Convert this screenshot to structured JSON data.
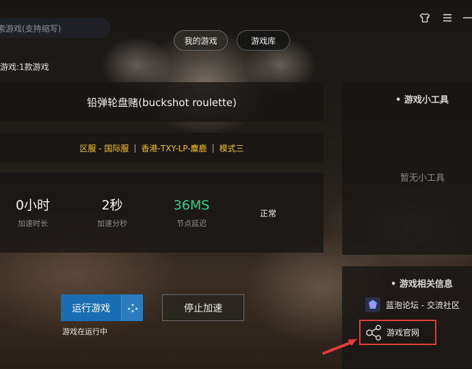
{
  "top": {
    "search_placeholder": "搜索游戏(支持缩写)",
    "search_visible": "索游戏(支持缩写)",
    "tabs": [
      {
        "label": "我的游戏",
        "active": true
      },
      {
        "label": "游戏库",
        "active": false
      }
    ],
    "icons": [
      "shirt-icon",
      "menu-icon",
      "minimize-icon"
    ]
  },
  "game_count": "游戏:1款游戏",
  "game": {
    "title": "铅弹轮盘赌(buckshot roulette)",
    "route": {
      "region": "区服 - 国际服",
      "node": "香港-TXY-LP-麋鹿",
      "mode": "模式三",
      "separator": "|",
      "color": "#f3c21b"
    },
    "stats": [
      {
        "value": "0小时",
        "label": "加速时长"
      },
      {
        "value": "2秒",
        "label": "加速分秒"
      },
      {
        "value": "36MS",
        "label": "节点延迟",
        "color": "#2fd08a"
      }
    ],
    "status": "正常"
  },
  "tools": {
    "heading": "• 游戏小工具",
    "empty": "暂无小工具"
  },
  "info": {
    "heading": "• 游戏相关信息",
    "forum": "蓝泡论坛 - 交流社区",
    "official": "游戏官网"
  },
  "actions": {
    "run": "运行游戏",
    "stop": "停止加速",
    "run_status": "游戏在运行中",
    "accent": "#1a6fb4"
  },
  "annotation_color": "#e23c3c"
}
